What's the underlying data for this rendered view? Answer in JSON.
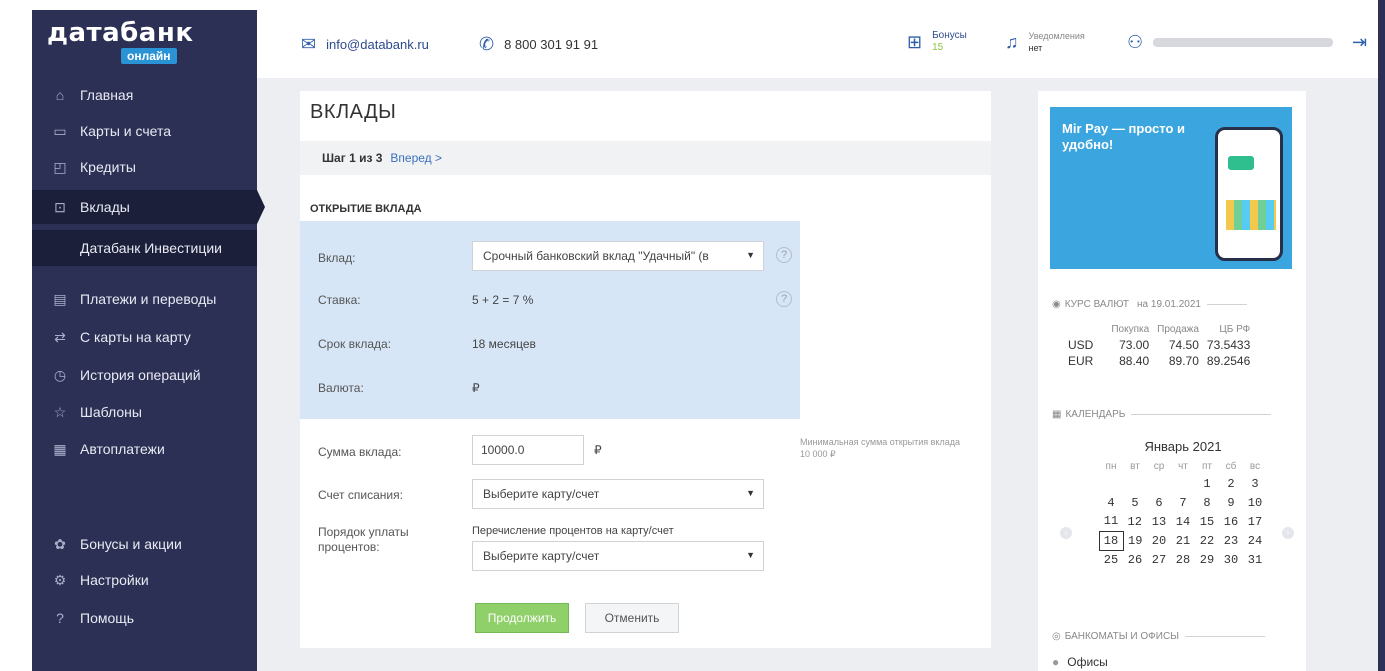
{
  "sidebar": {
    "logo": {
      "main": "датабанк",
      "sub": "онлайн"
    },
    "items": [
      {
        "label": "Главная",
        "icon": "home-icon"
      },
      {
        "label": "Карты и счета",
        "icon": "card-icon"
      },
      {
        "label": "Кредиты",
        "icon": "bag-icon"
      },
      {
        "label": "Вклады",
        "icon": "deposit-icon"
      },
      {
        "label": "Датабанк Инвестиции"
      },
      {
        "label": "Платежи и переводы",
        "icon": "payments-icon"
      },
      {
        "label": "С карты на карту",
        "icon": "card-transfer-icon"
      },
      {
        "label": "История операций",
        "icon": "history-icon"
      },
      {
        "label": "Шаблоны",
        "icon": "star-icon"
      },
      {
        "label": "Автоплатежи",
        "icon": "autopay-icon"
      },
      {
        "label": "Бонусы и акции",
        "icon": "bonus-icon"
      },
      {
        "label": "Настройки",
        "icon": "settings-icon"
      },
      {
        "label": "Помощь",
        "icon": "help-icon"
      }
    ]
  },
  "topbar": {
    "email": "info@databank.ru",
    "phone": "8 800 301 91 91",
    "bonuses_label": "Бонусы",
    "bonuses_count": "15",
    "notifications_label": "Уведомления",
    "notifications_value": "нет"
  },
  "main": {
    "title": "ВКЛАДЫ",
    "step": "Шаг 1 из 3",
    "next_link": "Вперед >",
    "section": "ОТКРЫТИЕ ВКЛАДА",
    "fields": {
      "deposit_label": "Вклад:",
      "deposit_value": "Срочный банковский вклад \"Удачный\" (в",
      "rate_label": "Ставка:",
      "rate_value": "5 + 2 = 7 %",
      "term_label": "Срок вклада:",
      "term_value": "18 месяцев",
      "currency_label": "Валюта:",
      "currency_value": "₽",
      "amount_label": "Сумма вклада:",
      "amount_value": "10000.0",
      "amount_currency": "₽",
      "amount_hint": "Минимальная сумма открытия вклада 10 000 ₽",
      "account_label": "Счет списания:",
      "account_value": "Выберите карту/счет",
      "interest_label": "Порядок уплаты процентов:",
      "interest_option": "Перечисление процентов на карту/счет",
      "interest_select": "Выберите карту/счет"
    },
    "continue_btn": "Продолжить",
    "cancel_btn": "Отменить"
  },
  "right": {
    "banner_title": "Mir Pay — просто и удобно!",
    "rates_heading": "КУРС ВАЛЮТ",
    "rates_date": "на 19.01.2021",
    "rates_cols": [
      "Покупка",
      "Продажа",
      "ЦБ РФ"
    ],
    "rates_rows": [
      [
        "USD",
        "73.00",
        "74.50",
        "73.5433"
      ],
      [
        "EUR",
        "88.40",
        "89.70",
        "89.2546"
      ]
    ],
    "calendar_heading": "КАЛЕНДАРЬ",
    "calendar_month": "Январь 2021",
    "calendar_days": [
      "пн",
      "вт",
      "ср",
      "чт",
      "пт",
      "сб",
      "вс"
    ],
    "calendar_weeks": [
      [
        "",
        "",
        "",
        "",
        "1",
        "2",
        "3"
      ],
      [
        "4",
        "5",
        "6",
        "7",
        "8",
        "9",
        "10"
      ],
      [
        "11",
        "12",
        "13",
        "14",
        "15",
        "16",
        "17"
      ],
      [
        "18",
        "19",
        "20",
        "21",
        "22",
        "23",
        "24"
      ],
      [
        "25",
        "26",
        "27",
        "28",
        "29",
        "30",
        "31"
      ]
    ],
    "calendar_today": "18",
    "atm_heading": "БАНКОМАТЫ И ОФИСЫ",
    "offices_label": "Офисы"
  }
}
